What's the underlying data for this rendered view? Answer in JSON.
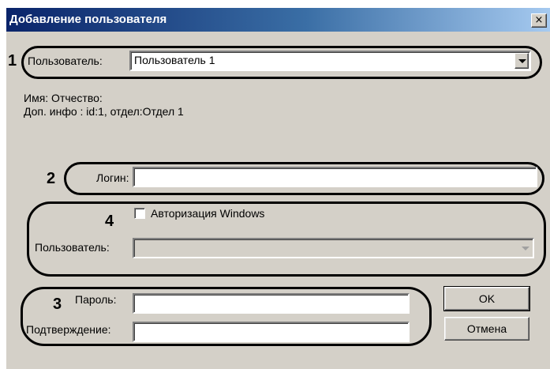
{
  "window": {
    "title": "Добавление пользователя",
    "close_glyph": "×"
  },
  "markers": [
    "1",
    "2",
    "3",
    "4"
  ],
  "user_section": {
    "label": "Пользователь:",
    "selected": "Пользователь 1",
    "info_name": "Имя: Отчество:",
    "info_extra": "Доп. инфо : id:1, отдел:Отдел 1"
  },
  "login_section": {
    "label": "Логин:",
    "value": ""
  },
  "windows_auth": {
    "checkbox_label": "Авторизация Windows",
    "checked": false,
    "user_label": "Пользователь:",
    "user_value": ""
  },
  "password_section": {
    "password_label": "Пароль:",
    "confirm_label": "Подтверждение:",
    "password_value": "",
    "confirm_value": ""
  },
  "buttons": {
    "ok": "OK",
    "cancel": "Отмена"
  },
  "icons": {
    "close": "close-icon",
    "dropdown": "chevron-down-icon"
  }
}
